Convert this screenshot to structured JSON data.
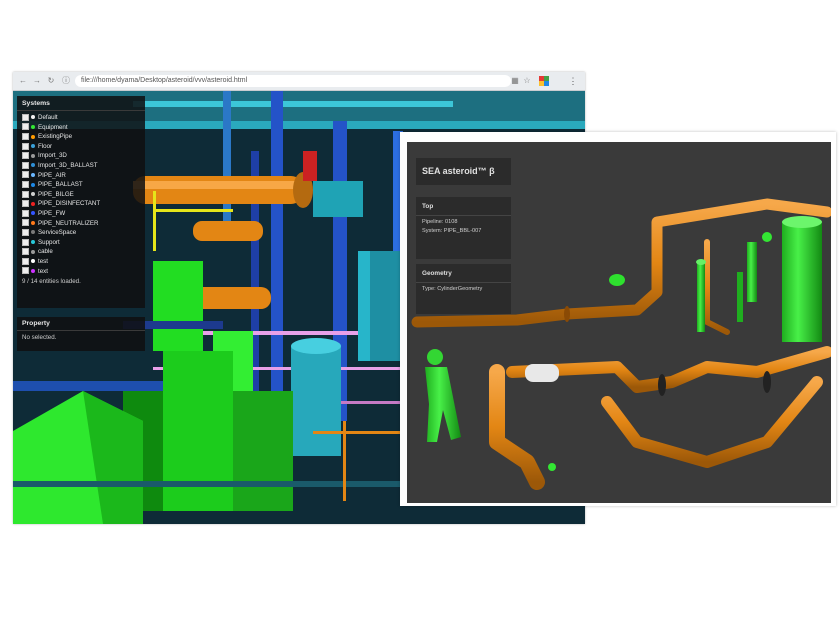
{
  "browser": {
    "url": "file:///home/dyama/Desktop/asteroid/vvv/asteroid.html"
  },
  "systems_panel": {
    "title": "Systems",
    "items": [
      {
        "label": "Default",
        "color": "#f2f2f2"
      },
      {
        "label": "Equipment",
        "color": "#33e633"
      },
      {
        "label": "ExistingPipe",
        "color": "#ff9b00"
      },
      {
        "label": "Floor",
        "color": "#3aa0d8"
      },
      {
        "label": "Import_3D",
        "color": "#9a9a9a"
      },
      {
        "label": "Import_3D_BALLAST",
        "color": "#2f8fd6"
      },
      {
        "label": "PIPE_AIR",
        "color": "#6bb7ff"
      },
      {
        "label": "PIPE_BALLAST",
        "color": "#1e88e5"
      },
      {
        "label": "PIPE_BILGE",
        "color": "#cfcfcf"
      },
      {
        "label": "PIPE_DISINFECTANT",
        "color": "#ee2222"
      },
      {
        "label": "PIPE_FW",
        "color": "#3355ff"
      },
      {
        "label": "PIPE_NEUTRALIZER",
        "color": "#ff7a1a"
      },
      {
        "label": "ServiceSpace",
        "color": "#7a7a7a"
      },
      {
        "label": "Support",
        "color": "#28c8d8"
      },
      {
        "label": "cable",
        "color": "#9a9a9a"
      },
      {
        "label": "test",
        "color": "#ffffff"
      },
      {
        "label": "text",
        "color": "#cc33ff"
      }
    ],
    "status": "9 / 14 entities loaded."
  },
  "property_panel": {
    "title": "Property",
    "empty_text": "No selected."
  },
  "viewer": {
    "app_title": "SEA asteroid™ β",
    "top_panel": {
      "title": "Top",
      "pipeline": "Pipeline: 0108",
      "system": "System: PIPE_BBL-007"
    },
    "geometry_panel": {
      "title": "Geometry",
      "type": "Type: CylinderGeometry"
    }
  },
  "colors": {
    "pipe_orange": "#e38614",
    "equipment_green": "#2fe02f",
    "support_cyan": "#1fa3b5",
    "viewer_bg": "#3a3a3a"
  }
}
